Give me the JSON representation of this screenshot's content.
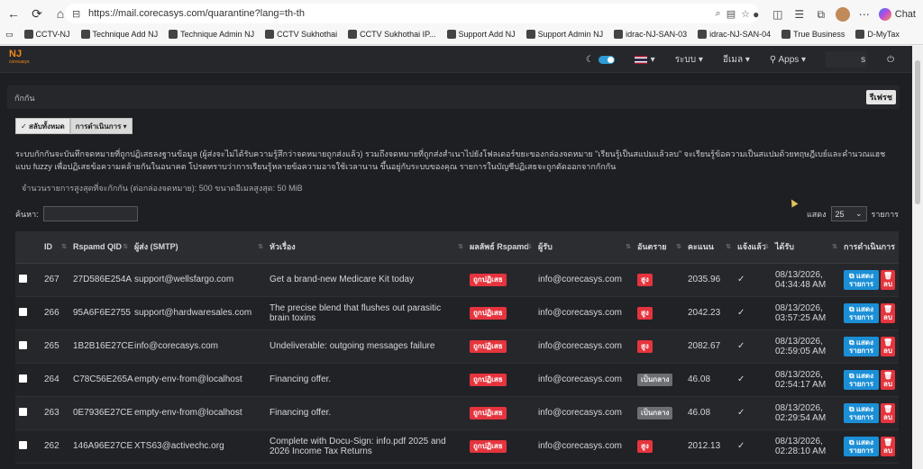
{
  "browser": {
    "url": "https://mail.corecasys.com/quarantine?lang=th-th",
    "profile_label": "Chat",
    "bookmarks": [
      {
        "label": "CCTV-NJ"
      },
      {
        "label": "Technique Add NJ"
      },
      {
        "label": "Technique Admin NJ"
      },
      {
        "label": "CCTV Sukhothai"
      },
      {
        "label": "CCTV Sukhothai IP..."
      },
      {
        "label": "Support Add NJ"
      },
      {
        "label": "Support Admin NJ"
      },
      {
        "label": "idrac-NJ-SAN-03"
      },
      {
        "label": "idrac-NJ-SAN-04"
      },
      {
        "label": "True Business"
      },
      {
        "label": "D-MyTax"
      }
    ]
  },
  "navbar": {
    "logo_text": "NJ",
    "logo_sub": "corecasys",
    "system_label": "ระบบ",
    "email_label": "อีเมล",
    "apps_label": "Apps",
    "user_suffix": "s"
  },
  "page": {
    "breadcrumb": "กักกัน",
    "refresh_label": "รีเฟรช",
    "select_all_label": "สลับทั้งหมด",
    "actions_label": "การดำเนินการ",
    "description": "ระบบกักกันจะบันทึกจดหมายที่ถูกปฏิเสธลงฐานข้อมูล (ผู้ส่งจะไม่ได้รับความรู้สึกว่าจดหมายถูกส่งแล้ว) รวมถึงจดหมายที่ถูกส่งสำเนาไปยังโฟลเดอร์ขยะของกล่องจดหมาย \"เรียนรู้เป็นสแปมแล้วลบ\" จะเรียนรู้ข้อความเป็นสแปมด้วยทฤษฎีเบย์และคำนวณแฮชแบบ fuzzy เพื่อปฏิเสธข้อความคล้ายกันในอนาคต โปรดทราบว่าการเรียนรู้หลายข้อความอาจใช้เวลานาน ขึ้นอยู่กับระบบของคุณ รายการในบัญชีปฏิเสธจะถูกตัดออกจากกักกัน",
    "limits": "จำนวนรายการสูงสุดที่จะกักกัน (ต่อกล่องจดหมาย): 500 ขนาดอีเมลสูงสุด: 50 MiB",
    "search_label": "ค้นหา:",
    "show_label": "แสดง",
    "show_value": "25",
    "items_label": "รายการ"
  },
  "table": {
    "headers": {
      "id": "ID",
      "qid": "Rspamd QID",
      "sender": "ผู้ส่ง (SMTP)",
      "subject": "หัวเรื่อง",
      "result": "ผลลัพธ์ Rspamd",
      "rcpt": "ผู้รับ",
      "danger": "อันตราย",
      "score": "คะแนน",
      "notified": "แจ้งแล้ว",
      "received": "ได้รับ",
      "actions": "การดำเนินการ"
    },
    "edit_label": "แสดง รายการ",
    "delete_label": "ลบ",
    "rows": [
      {
        "id": "267",
        "qid": "27D586E254A",
        "sender": "support@wellsfargo.com",
        "subject": "Get a brand-new Medicare Kit today",
        "result": "ถูกปฏิเสธ",
        "rcpt": "info@corecasys.com",
        "danger": "สูง",
        "danger_level": "high",
        "score": "2035.96",
        "notified": "✓",
        "received": "08/13/2026, 04:34:48 AM"
      },
      {
        "id": "266",
        "qid": "95A6F6E2755",
        "sender": "support@hardwaresales.com",
        "subject": "The precise blend that flushes out parasitic brain toxins",
        "result": "ถูกปฏิเสธ",
        "rcpt": "info@corecasys.com",
        "danger": "สูง",
        "danger_level": "high",
        "score": "2042.23",
        "notified": "✓",
        "received": "08/13/2026, 03:57:25 AM"
      },
      {
        "id": "265",
        "qid": "1B2B16E27CE",
        "sender": "info@corecasys.com",
        "subject": "Undeliverable: outgoing messages failure",
        "result": "ถูกปฏิเสธ",
        "rcpt": "info@corecasys.com",
        "danger": "สูง",
        "danger_level": "high",
        "score": "2082.67",
        "notified": "✓",
        "received": "08/13/2026, 02:59:05 AM"
      },
      {
        "id": "264",
        "qid": "C78C56E265A",
        "sender": "empty-env-from@localhost",
        "subject": "Financing offer.",
        "result": "ถูกปฏิเสธ",
        "rcpt": "info@corecasys.com",
        "danger": "เป็นกลาง",
        "danger_level": "neutral",
        "score": "46.08",
        "notified": "✓",
        "received": "08/13/2026, 02:54:17 AM"
      },
      {
        "id": "263",
        "qid": "0E7936E27CE",
        "sender": "empty-env-from@localhost",
        "subject": "Financing offer.",
        "result": "ถูกปฏิเสธ",
        "rcpt": "info@corecasys.com",
        "danger": "เป็นกลาง",
        "danger_level": "neutral",
        "score": "46.08",
        "notified": "✓",
        "received": "08/13/2026, 02:29:54 AM"
      },
      {
        "id": "262",
        "qid": "146A96E27CE",
        "sender": "XTS63@activechc.org",
        "subject": "Complete with Docu-Sign: info.pdf 2025 and 2026 Income Tax Returns",
        "result": "ถูกปฏิเสธ",
        "rcpt": "info@corecasys.com",
        "danger": "สูง",
        "danger_level": "high",
        "score": "2012.13",
        "notified": "✓",
        "received": "08/13/2026, 02:28:10 AM"
      }
    ]
  }
}
